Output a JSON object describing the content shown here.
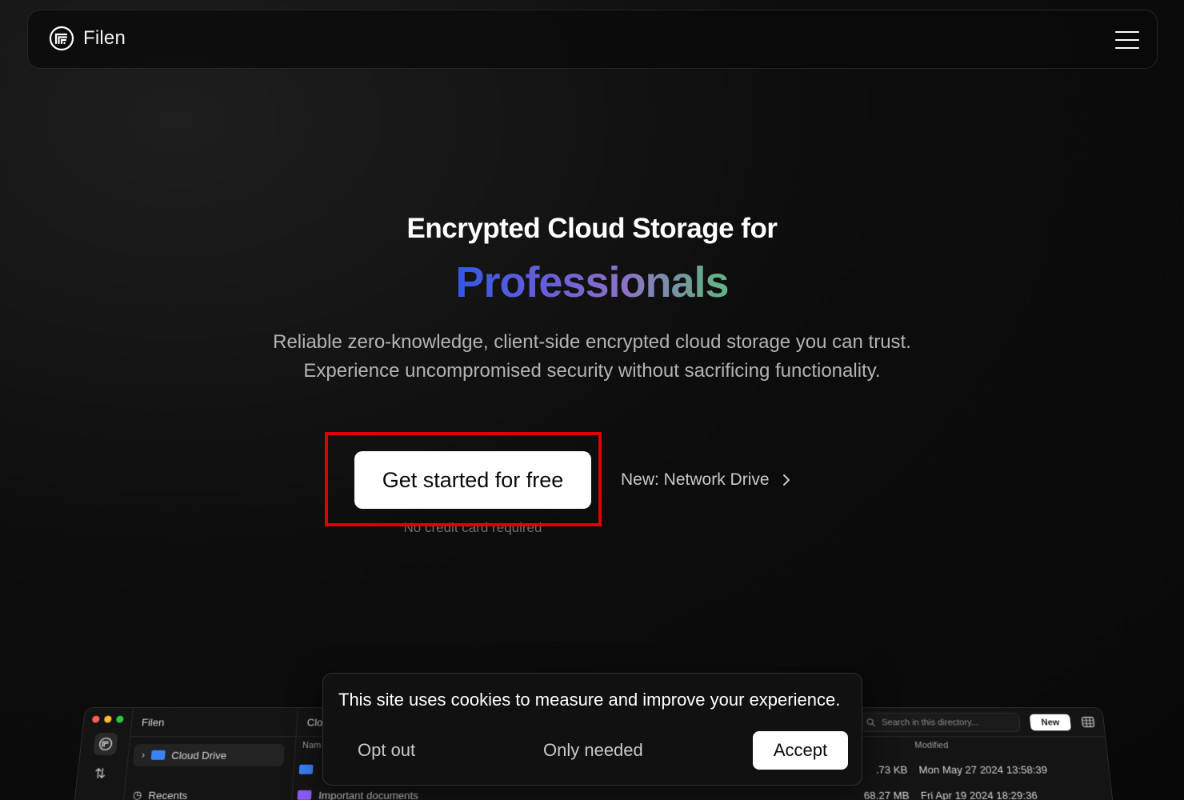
{
  "nav": {
    "brand": "Filen",
    "logo_icon": "filen-logo-icon",
    "menu_icon": "hamburger-menu-icon"
  },
  "hero": {
    "title_line1": "Encrypted Cloud Storage for",
    "title_line2": "Professionals",
    "subtitle_line1": "Reliable zero-knowledge, client-side encrypted cloud storage you can trust.",
    "subtitle_line2": "Experience uncompromised security without sacrificing functionality.",
    "gradient_colors": [
      "#3358e6",
      "#6a5fd8",
      "#8d72c7",
      "#5fb87e"
    ]
  },
  "cta": {
    "primary_label": "Get started for free",
    "note": "No credit card required",
    "secondary_label": "New: Network Drive",
    "secondary_icon": "chevron-right-icon",
    "highlight_color": "#e10000"
  },
  "preview": {
    "app_title": "Filen",
    "traffic_colors": [
      "#ff5f57",
      "#febc2e",
      "#28c840"
    ],
    "sidebar": {
      "cloud_drive": "Cloud Drive",
      "recents": "Recents"
    },
    "main": {
      "breadcrumb": "Clo",
      "col_name": "Nam",
      "col_modified": "Modified",
      "search_placeholder": "Search in this directory...",
      "new_button": "New",
      "files": [
        {
          "name": "",
          "size": ".73 KB",
          "modified": "Mon May 27 2024 13:58:39",
          "color": "#3b82f6"
        },
        {
          "name": "Important documents",
          "size": "68.27 MB",
          "modified": "Fri Apr 19 2024 18:29:36",
          "color": "#8b5cf6"
        }
      ]
    }
  },
  "cookie": {
    "message": "This site uses cookies to measure and improve your experience.",
    "opt_out": "Opt out",
    "only_needed": "Only needed",
    "accept": "Accept"
  }
}
